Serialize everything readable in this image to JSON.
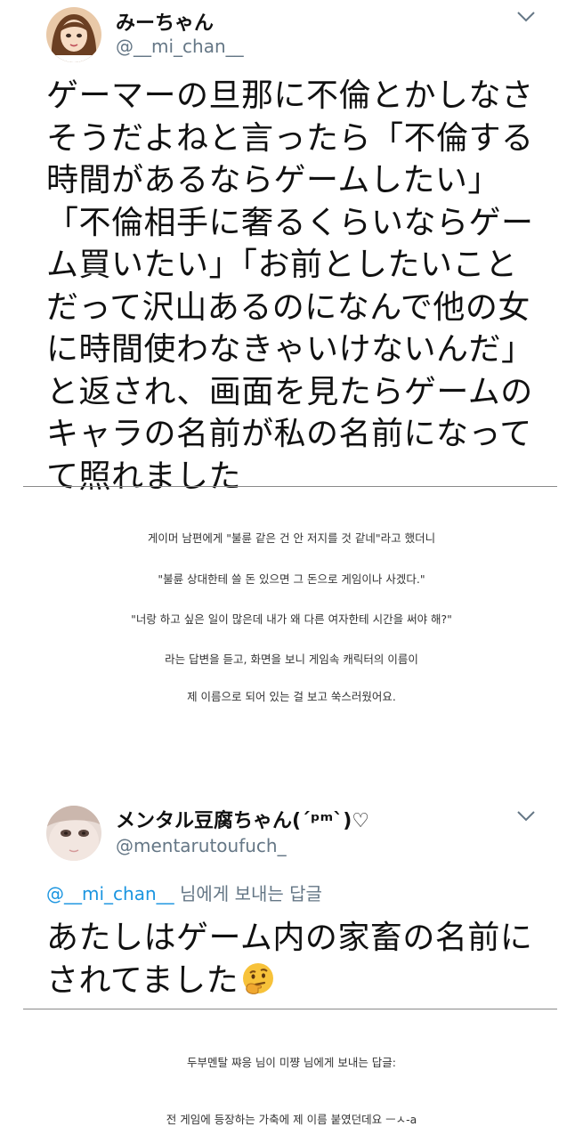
{
  "tweet1": {
    "display_name": "みーちゃん",
    "handle": "@__mi_chan__",
    "text": "ゲーマーの旦那に不倫とかしなさそうだよねと言ったら「不倫する時間があるならゲームしたい」「不倫相手に奢るくらいならゲーム買いたい」「お前としたいことだって沢山あるのになんで他の女に時間使わなきゃいけないんだ」と返され、画面を見たらゲームのキャラの名前が私の名前になってて照れました",
    "lines": [
      "ゲーマーの旦那に不倫とかしなさ",
      "そうだよねと言ったら「不倫する",
      "時間があるならゲームしたい」",
      "「不倫相手に奢るくらいならゲー",
      "ム買いたい」「お前としたいこと",
      "だって沢山あるのになんで他の女",
      "に時間使わなきゃいけないんだ」",
      "と返され、画面を見たらゲームの",
      "キャラの名前が私の名前になって",
      "て照れました"
    ]
  },
  "translation1": [
    "게이머 남편에게 \"불륜 같은 건 안 저지를 것 같네\"라고 했더니",
    "\"불륜 상대한테 쓸 돈 있으면 그 돈으로 게임이나 사겠다.\"",
    "\"너랑 하고 싶은 일이 많은데 내가 왜 다른 여자한테 시간을 써야 해?\"",
    "라는 답변을 듣고, 화면을 보니 게임속 캐릭터의 이름이",
    "제 이름으로 되어 있는 걸 보고 쑥스러웠어요."
  ],
  "tweet2": {
    "display_name": "メンタル豆腐ちゃん(´ᵖᵐ`)♡",
    "handle": "@mentarutoufuch_",
    "reply_mention": "@__mi_chan__",
    "reply_suffix": " 님에게 보내는 답글",
    "lines": [
      "あたしはゲーム内の家畜の名前に",
      "されてました"
    ],
    "emoji": "thinking-face"
  },
  "translation2": [
    "두부멘탈 쨔응 님이 미쨩 님에게 보내는 답글:",
    "전 게임에 등장하는 가축에 제 이름 붙였던데요 ㅡㅅ-a"
  ],
  "colors": {
    "handle": "#657786",
    "mention": "#1b95e0",
    "divider": "#8a8a8a"
  }
}
